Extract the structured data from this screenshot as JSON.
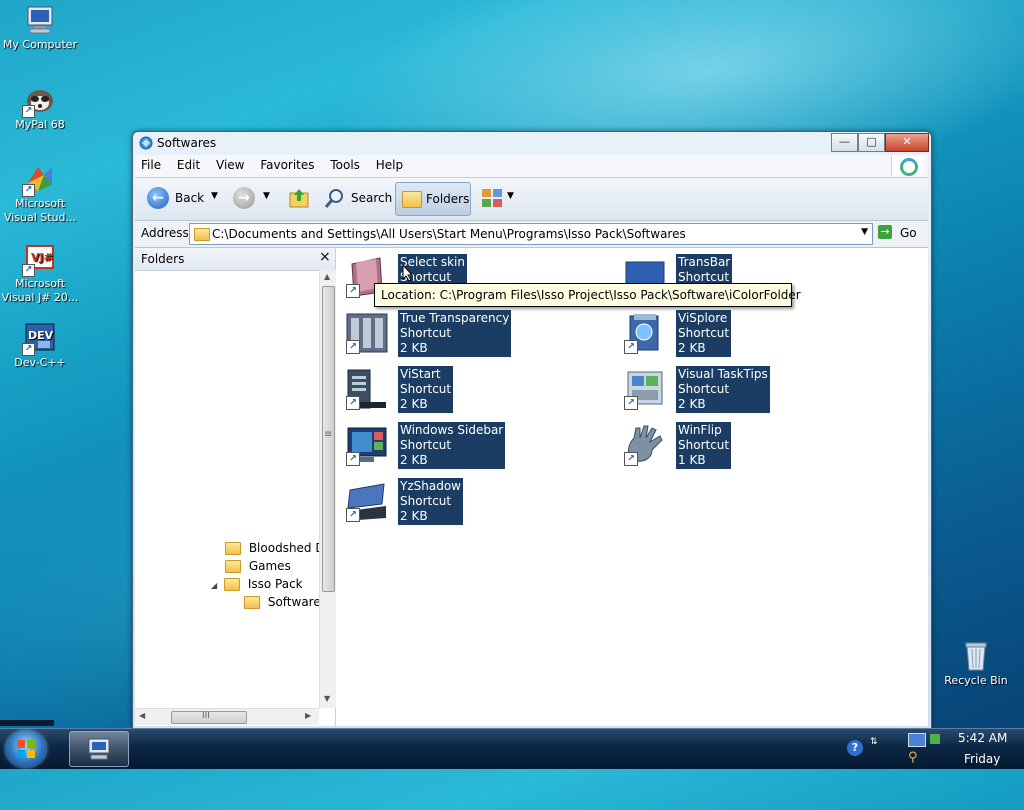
{
  "desktop": {
    "icons": [
      {
        "label": "My Computer"
      },
      {
        "label": "MyPal 68"
      },
      {
        "label": "Microsoft Visual Stud..."
      },
      {
        "label": "Microsoft Visual J# 20..."
      },
      {
        "label": "Dev-C++"
      },
      {
        "label": "Recycle Bin"
      }
    ]
  },
  "window": {
    "title": "Softwares",
    "menu": [
      "File",
      "Edit",
      "View",
      "Favorites",
      "Tools",
      "Help"
    ],
    "toolbar": {
      "back": "Back",
      "search": "Search",
      "folders": "Folders"
    },
    "address": {
      "label": "Address",
      "value": "C:\\Documents and Settings\\All Users\\Start Menu\\Programs\\Isso Pack\\Softwares",
      "go": "Go"
    },
    "folders_pane": {
      "title": "Folders",
      "close": "×",
      "tree": [
        {
          "label": "Bloodshed De"
        },
        {
          "label": "Games"
        },
        {
          "label": "Isso Pack"
        },
        {
          "label": "Softwares"
        }
      ],
      "hscroll_grip": "III",
      "vscroll_grip": "≡"
    },
    "items": [
      {
        "name": "Select skin",
        "type": "Shortcut",
        "size": ""
      },
      {
        "name": "TransBar",
        "type": "Shortcut",
        "size": ""
      },
      {
        "name": "True Transparency",
        "type": "Shortcut",
        "size": "2 KB"
      },
      {
        "name": "ViSplore",
        "type": "Shortcut",
        "size": "2 KB"
      },
      {
        "name": "ViStart",
        "type": "Shortcut",
        "size": "2 KB"
      },
      {
        "name": "Visual TaskTips",
        "type": "Shortcut",
        "size": "2 KB"
      },
      {
        "name": "Windows Sidebar",
        "type": "Shortcut",
        "size": "2 KB"
      },
      {
        "name": "WinFlip",
        "type": "Shortcut",
        "size": "1 KB"
      },
      {
        "name": "YzShadow",
        "type": "Shortcut",
        "size": "2 KB"
      }
    ],
    "tooltip": "Location: C:\\Program Files\\Isso Project\\Isso Pack\\Software\\iColorFolder"
  },
  "taskbar": {
    "time": "5:42 AM",
    "day": "Friday"
  },
  "colors": {
    "selection": "#1c3d63",
    "tooltip_bg": "#ffffe1"
  }
}
